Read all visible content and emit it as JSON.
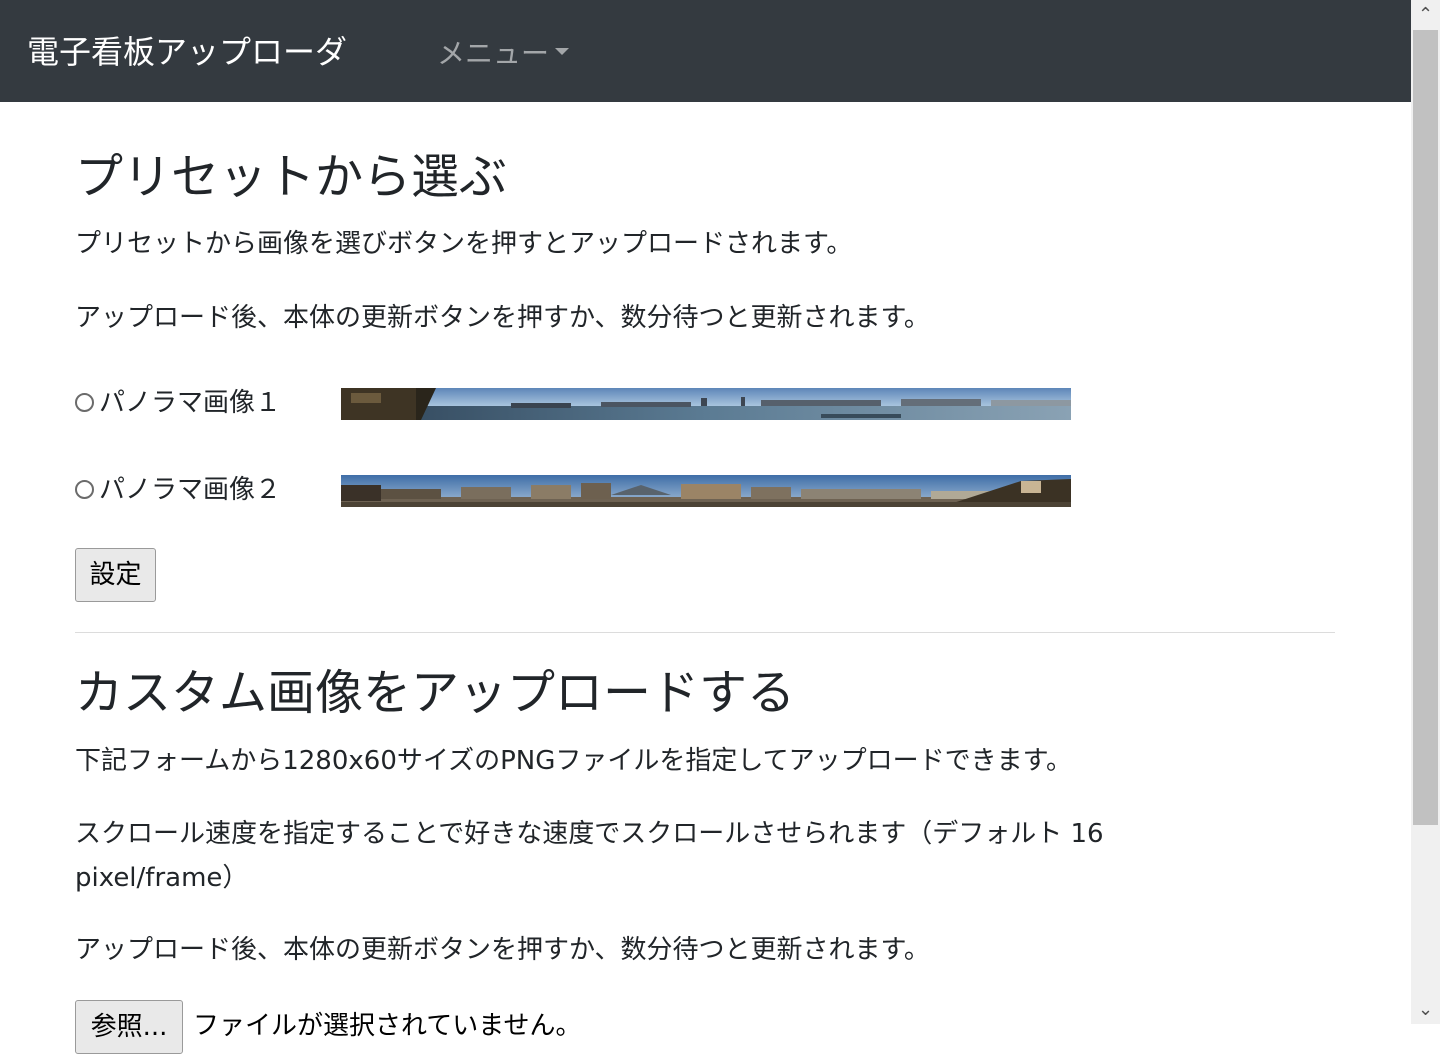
{
  "navbar": {
    "brand": "電子看板アップローダ",
    "menu_label": "メニュー"
  },
  "preset": {
    "heading": "プリセットから選ぶ",
    "desc1": "プリセットから画像を選びボタンを押すとアップロードされます。",
    "desc2": "アップロード後、本体の更新ボタンを押すか、数分待つと更新されます。",
    "options": [
      {
        "label": "パノラマ画像１",
        "selected": false
      },
      {
        "label": "パノラマ画像２",
        "selected": false
      }
    ],
    "submit_label": "設定"
  },
  "custom": {
    "heading": "カスタム画像をアップロードする",
    "desc1": "下記フォームから1280x60サイズのPNGファイルを指定してアップロードできます。",
    "desc2": "スクロール速度を指定することで好きな速度でスクロールさせられます（デフォルト 16 pixel/frame）",
    "desc3": "アップロード後、本体の更新ボタンを押すか、数分待つと更新されます。",
    "browse_label": "参照...",
    "file_status": "ファイルが選択されていません。"
  },
  "icons": {
    "menu_caret": "caret-down-icon",
    "scroll_up": "scroll-up-arrow-icon",
    "scroll_down": "scroll-down-arrow-icon"
  },
  "colors": {
    "navbar_bg": "#343a40",
    "page_bg": "#ffffff",
    "text": "#212529"
  }
}
